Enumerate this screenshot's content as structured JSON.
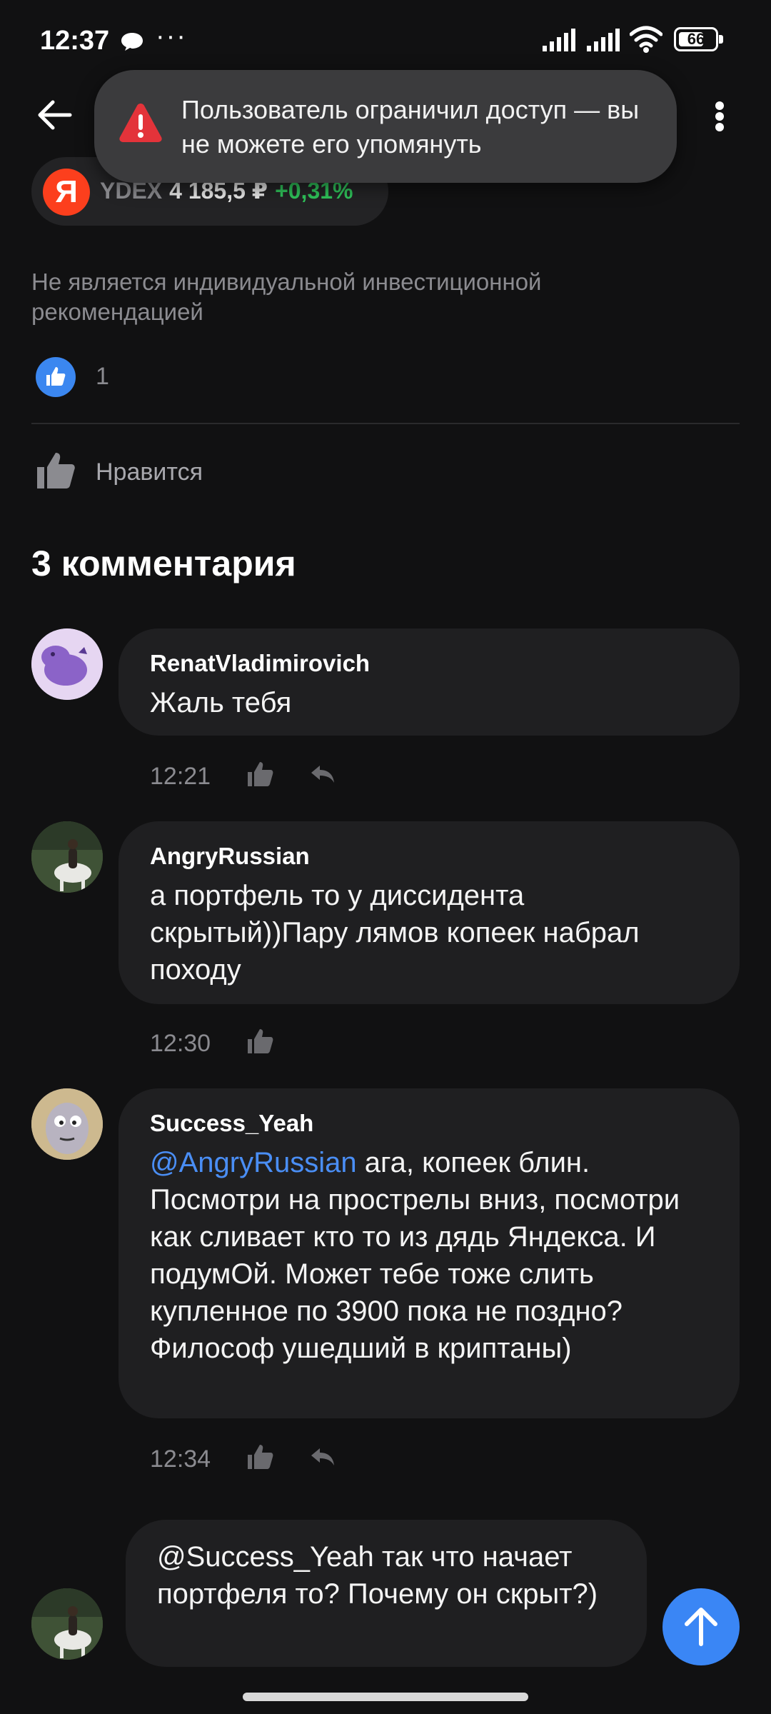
{
  "status_bar": {
    "time": "12:37",
    "dots": "···",
    "battery": "66"
  },
  "header": {
    "back_icon": "arrow-left-icon",
    "menu_icon": "more-vertical-icon"
  },
  "toast": {
    "icon": "warning-icon",
    "text": "Пользователь ограничил доступ — вы не можете его упомянуть"
  },
  "ticker": {
    "logo": "Я",
    "symbol": "YDEX",
    "price": "4 185,5 ₽",
    "change": "+0,31%",
    "change_color": "#2fc35a",
    "brand_color": "#fc3f1d"
  },
  "post": {
    "disclaimer": "Не является индивидуальной инвестиционной рекомендацией",
    "like_count": "1",
    "like_action_label": "Нравится"
  },
  "comments": {
    "title": "3 комментария",
    "items": [
      {
        "author": "RenatVladimirovich",
        "mention": "",
        "text": "Жаль тебя",
        "time": "12:21"
      },
      {
        "author": "AngryRussian",
        "mention": "",
        "text": "а портфель то у диссидента скрытый))Пару лямов копеек набрал походу",
        "time": "12:30"
      },
      {
        "author": "Success_Yeah",
        "mention": "@AngryRussian",
        "text": " ага, копеек блин. Посмотри на прострелы вниз, посмотри как сливает кто то из дядь Яндекса. И подумОй. Может тебе тоже слить купленное по 3900 пока не поздно? Философ ушедший в криптаны)",
        "time": "12:34"
      }
    ]
  },
  "compose": {
    "text": "@Success_Yeah так что начает портфеля то? Почему он скрыт?)",
    "send_icon": "arrow-up-icon"
  },
  "colors": {
    "background": "#111112",
    "bubble": "#1f1f21",
    "accent": "#3a86f5",
    "mention": "#4a8ef5",
    "muted_text": "#8b8b90"
  }
}
